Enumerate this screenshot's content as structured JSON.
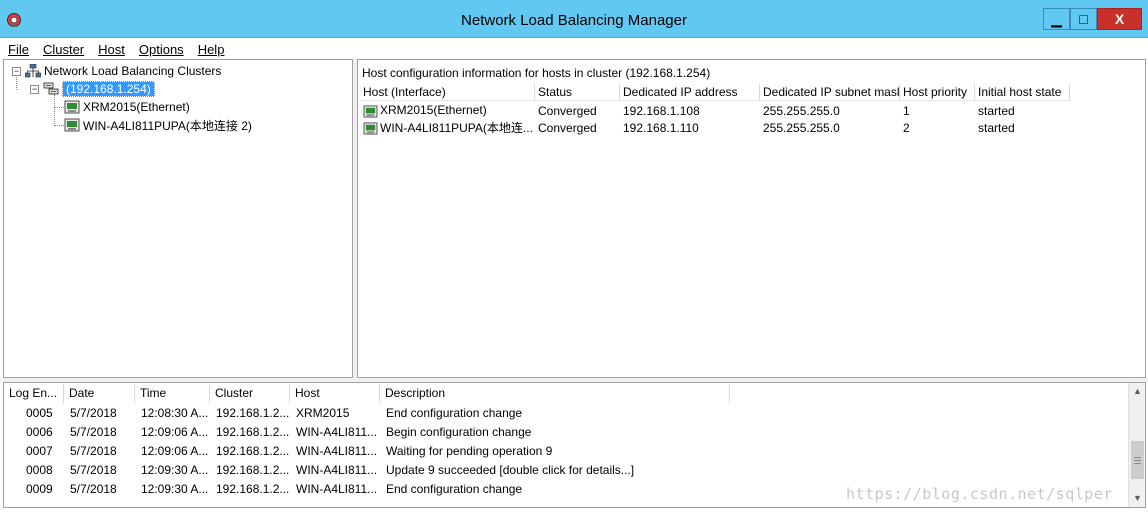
{
  "window": {
    "title": "Network Load Balancing Manager",
    "min_glyph": "▁",
    "max_glyph": "□",
    "close_glyph": "X"
  },
  "menu": [
    {
      "label": "File"
    },
    {
      "label": "Cluster"
    },
    {
      "label": "Host"
    },
    {
      "label": "Options"
    },
    {
      "label": "Help"
    }
  ],
  "tree": {
    "root": "Network Load Balancing Clusters",
    "cluster": "(192.168.1.254)",
    "hosts": [
      "XRM2015(Ethernet)",
      "WIN-A4LI811PUPA(本地连接 2)"
    ],
    "root_expander": "⊟",
    "cluster_expander": "⊟"
  },
  "detail": {
    "caption": "Host configuration information for hosts in cluster  (192.168.1.254)",
    "columns": [
      "Host (Interface)",
      "Status",
      "Dedicated IP address",
      "Dedicated IP subnet mask",
      "Host priority",
      "Initial host state"
    ],
    "rows": [
      [
        "XRM2015(Ethernet)",
        "Converged",
        "192.168.1.108",
        "255.255.255.0",
        "1",
        "started"
      ],
      [
        "WIN-A4LI811PUPA(本地连...",
        "Converged",
        "192.168.1.110",
        "255.255.255.0",
        "2",
        "started"
      ]
    ]
  },
  "log": {
    "columns": [
      "Log En...",
      "Date",
      "Time",
      "Cluster",
      "Host",
      "Description"
    ],
    "rows": [
      [
        "0005",
        "5/7/2018",
        "12:08:30 A...",
        "192.168.1.2...",
        "XRM2015",
        "End configuration change"
      ],
      [
        "0006",
        "5/7/2018",
        "12:09:06 A...",
        "192.168.1.2...",
        "WIN-A4LI811...",
        "Begin configuration change"
      ],
      [
        "0007",
        "5/7/2018",
        "12:09:06 A...",
        "192.168.1.2...",
        "WIN-A4LI811...",
        "Waiting for pending operation 9"
      ],
      [
        "0008",
        "5/7/2018",
        "12:09:30 A...",
        "192.168.1.2...",
        "WIN-A4LI811...",
        "Update 9 succeeded [double click for details...]"
      ],
      [
        "0009",
        "5/7/2018",
        "12:09:30 A...",
        "192.168.1.2...",
        "WIN-A4LI811...",
        "End configuration change"
      ]
    ],
    "scroll_up": "▲",
    "scroll_down": "▼"
  },
  "watermark": "https://blog.csdn.net/sqlper",
  "colors": {
    "titlebar": "#61c8f2",
    "close_button": "#c9302c",
    "selection": "#3399ff"
  },
  "icons": {
    "app": "nlb-app-icon",
    "root": "network-clusters-icon",
    "cluster": "cluster-icon",
    "host": "host-computer-icon"
  }
}
